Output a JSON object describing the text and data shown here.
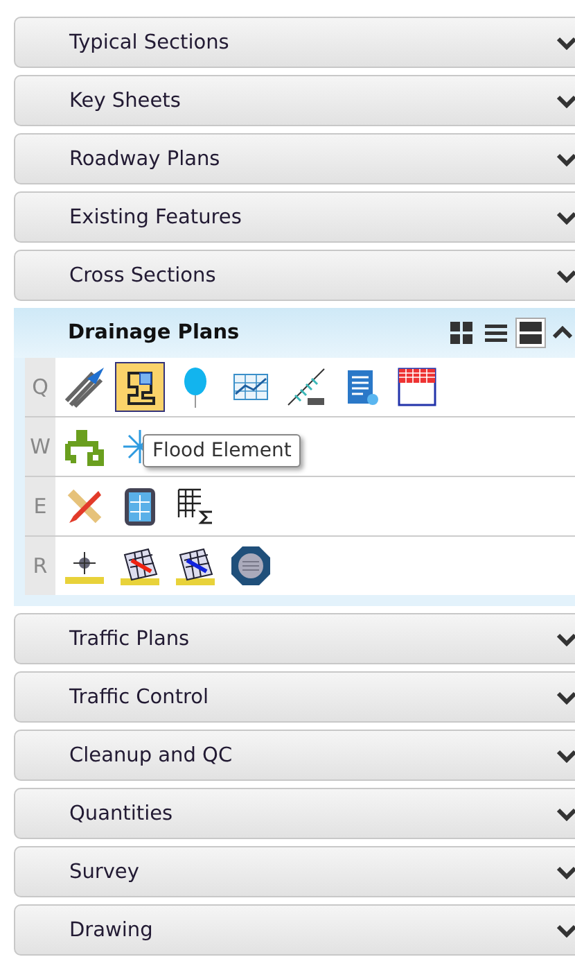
{
  "sections": [
    {
      "label": "Typical Sections",
      "expanded": false
    },
    {
      "label": "Key Sheets",
      "expanded": false
    },
    {
      "label": "Roadway Plans",
      "expanded": false
    },
    {
      "label": "Existing Features",
      "expanded": false
    },
    {
      "label": "Cross Sections",
      "expanded": false
    },
    {
      "label": "Drainage Plans",
      "expanded": true,
      "view_modes": [
        {
          "kind": "tiles",
          "selected": false
        },
        {
          "kind": "list",
          "selected": false
        },
        {
          "kind": "rows",
          "selected": true
        }
      ],
      "tool_rows": [
        {
          "key": "Q",
          "tools": [
            {
              "kind": "pipes",
              "selected": false
            },
            {
              "kind": "outline",
              "selected": true
            },
            {
              "kind": "balloon",
              "selected": false
            },
            {
              "kind": "graph",
              "selected": false
            },
            {
              "kind": "profile",
              "selected": false
            },
            {
              "kind": "document",
              "selected": false
            },
            {
              "kind": "grid",
              "selected": false
            }
          ]
        },
        {
          "key": "W",
          "tools": [
            {
              "kind": "faucet",
              "selected": false
            },
            {
              "kind": "sparkle",
              "selected": false
            }
          ],
          "tooltip": "Flood Element"
        },
        {
          "key": "E",
          "tools": [
            {
              "kind": "pencil",
              "selected": false
            },
            {
              "kind": "calculator",
              "selected": false
            },
            {
              "kind": "sumtable",
              "selected": false
            }
          ]
        },
        {
          "key": "R",
          "tools": [
            {
              "kind": "marker",
              "selected": false
            },
            {
              "kind": "meshred",
              "selected": false
            },
            {
              "kind": "meshblue",
              "selected": false
            },
            {
              "kind": "grate",
              "selected": false
            }
          ]
        }
      ]
    },
    {
      "label": "Traffic Plans",
      "expanded": false
    },
    {
      "label": "Traffic Control",
      "expanded": false
    },
    {
      "label": "Cleanup and QC",
      "expanded": false
    },
    {
      "label": "Quantities",
      "expanded": false
    },
    {
      "label": "Survey",
      "expanded": false
    },
    {
      "label": "Drawing",
      "expanded": false
    }
  ]
}
